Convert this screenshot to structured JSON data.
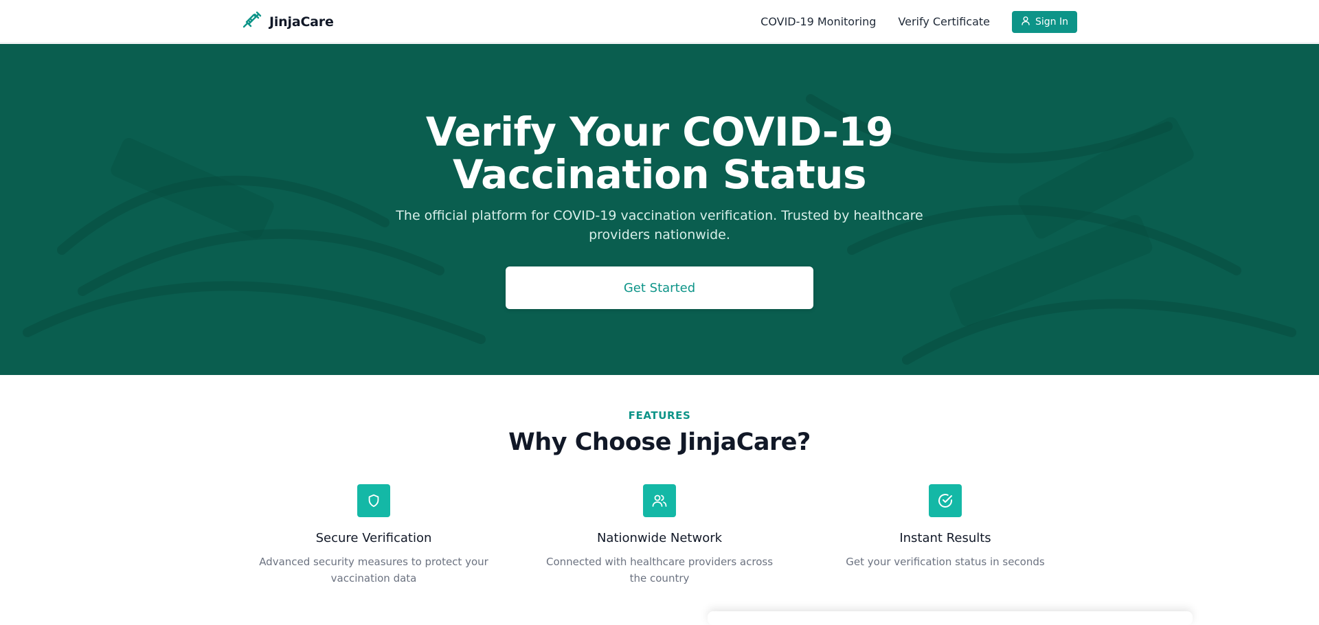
{
  "header": {
    "brand": "JinjaCare",
    "nav": [
      "COVID-19 Monitoring",
      "Verify Certificate"
    ],
    "signin_label": "Sign In"
  },
  "hero": {
    "title_line1": "Verify Your COVID-19",
    "title_line2": "Vaccination Status",
    "subtitle": "The official platform for COVID-19 vaccination verification. Trusted by healthcare providers nationwide.",
    "cta_label": "Get Started"
  },
  "features": {
    "eyebrow": "FEATURES",
    "title": "Why Choose JinjaCare?",
    "items": [
      {
        "icon": "shield-icon",
        "title": "Secure Verification",
        "description": "Advanced security measures to protect your vaccination data"
      },
      {
        "icon": "users-icon",
        "title": "Nationwide Network",
        "description": "Connected with healthcare providers across the country"
      },
      {
        "icon": "check-circle-icon",
        "title": "Instant Results",
        "description": "Get your verification status in seconds"
      }
    ]
  },
  "colors": {
    "primary": "#0d9488",
    "hero_bg": "#0a5e4f",
    "feature_icon_bg": "#14b8a6",
    "heading": "#111827",
    "muted_text": "#6b7280"
  }
}
